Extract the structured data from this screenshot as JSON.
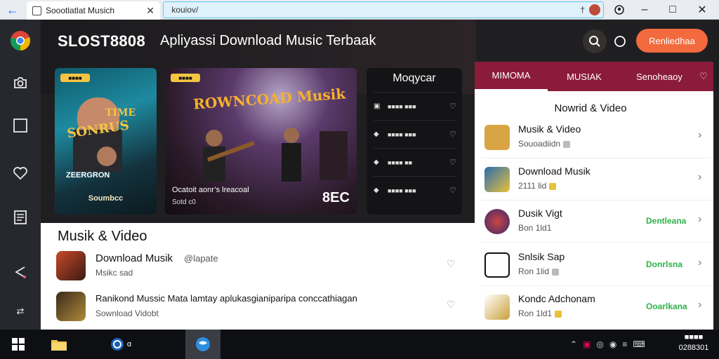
{
  "browser": {
    "tab_title": "Soootlatlat Musich",
    "url": " kouiov/",
    "extension_label": "†"
  },
  "header": {
    "brand": "SLOST8808",
    "headline": "Apliyassi Download Music Terbaak",
    "cta_label": "Renliedhaa"
  },
  "cards": [
    {
      "tag": "■■■■",
      "poster_text": "SONRUS",
      "poster_sub": "ZEERGRON",
      "caption": "Soumbcc"
    },
    {
      "tag": "■■■■",
      "title": "ROWNCOAD Musik",
      "sub": "Ocatoit aonr’s lreacoal",
      "meta": "Sotd c0",
      "count": "8EC"
    }
  ],
  "side_list": {
    "heading": "Moqycar",
    "items": [
      {
        "label": "■■■■ ■■■"
      },
      {
        "label": "■■■■ ■■■"
      },
      {
        "label": "■■■■ ■■"
      },
      {
        "label": "■■■■ ■■■"
      }
    ]
  },
  "section": {
    "title": "Musik & Video",
    "rows": [
      {
        "title": "Download Musik",
        "handle": "@lapate",
        "meta": "Msikc sad"
      },
      {
        "title": "Ranikond Mussic Mata lamtay aplukasgianiparipa conccathiagan",
        "handle": "",
        "meta": "Sownload Vidobt"
      }
    ]
  },
  "right_panel": {
    "tabs": [
      "MIMOMA",
      "MUSIAK",
      "Senoheaoy"
    ],
    "title": "Nowrid & Video",
    "items": [
      {
        "name": "Musik & Video",
        "meta": "Souoadiidn",
        "action": ""
      },
      {
        "name": "Download Musik",
        "meta": "2111 lid",
        "action": ""
      },
      {
        "name": "Dusik Vigt",
        "meta": "Bon 1ld1",
        "action": "Dentleana"
      },
      {
        "name": "Snlsik Sap",
        "meta": "Ron 1lid",
        "action": "Donrlsna"
      },
      {
        "name": "Kondc Adchonam",
        "meta": "Ron 1ld1",
        "action": "Ooarlkana"
      }
    ]
  },
  "taskbar": {
    "app_label": "α",
    "clock_line1": "■■■■",
    "clock_line2": "0288301"
  },
  "colors": {
    "accent": "#f26a3d",
    "panel_tab_bg": "#8a1b3a",
    "action_green": "#2fb14a"
  }
}
